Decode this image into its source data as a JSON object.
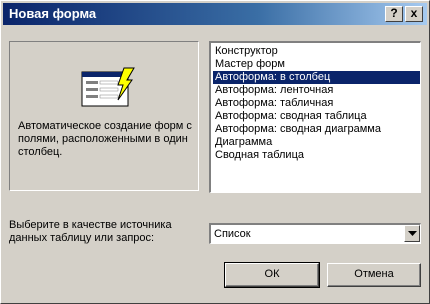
{
  "window": {
    "title": "Новая форма",
    "help_label": "?",
    "close_label": "x"
  },
  "preview": {
    "icon": "form-wizard-icon",
    "description": "Автоматическое создание форм с полями, расположенными в один столбец."
  },
  "listbox": {
    "items": [
      "Конструктор",
      "Мастер форм",
      "Автоформа: в столбец",
      "Автоформа: ленточная",
      "Автоформа: табличная",
      "Автоформа:  сводная таблица",
      "Автоформа:  сводная диаграмма",
      "Диаграмма",
      "Сводная таблица"
    ],
    "selected": "Автоформа: в столбец"
  },
  "source": {
    "label": "Выберите в качестве источника данных таблицу или запрос:",
    "value": "Список"
  },
  "buttons": {
    "ok": "ОК",
    "cancel": "Отмена"
  },
  "colors": {
    "title_bar": "#0a246a",
    "selection": "#0a246a",
    "face": "#d4d0c8"
  }
}
